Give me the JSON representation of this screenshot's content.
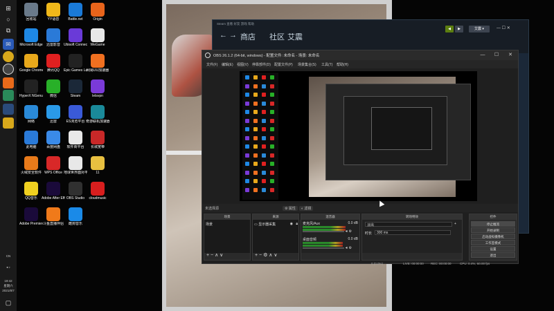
{
  "desktop": {
    "icons": [
      {
        "label": "回收站",
        "icon": "recycle-bin-icon",
        "color": "#6a7a8a"
      },
      {
        "label": "YY语音",
        "icon": "yy-voice-icon",
        "color": "#f0b81a"
      },
      {
        "label": "Battle.net",
        "icon": "battlenet-icon",
        "color": "#1a7ad8"
      },
      {
        "label": "Origin",
        "icon": "origin-icon",
        "color": "#e8641b"
      },
      {
        "label": "Microsoft Edge",
        "icon": "edge-icon",
        "color": "#1e88e5"
      },
      {
        "label": "迅雷影音",
        "icon": "xunlei-player-icon",
        "color": "#2a7ad8"
      },
      {
        "label": "Ubisoft Connect",
        "icon": "ubisoft-icon",
        "color": "#6a3ad8"
      },
      {
        "label": "WeGame",
        "icon": "wegame-icon",
        "color": "#e8e8e8"
      },
      {
        "label": "Google Chrome",
        "icon": "chrome-icon",
        "color": "#e8a81b"
      },
      {
        "label": "腾讯QQ",
        "icon": "qq-icon",
        "color": "#e02020"
      },
      {
        "label": "Epic Games Launcher",
        "icon": "epic-games-icon",
        "color": "#222222"
      },
      {
        "label": "网易UU加速器",
        "icon": "uu-accelerator-icon",
        "color": "#f07020"
      },
      {
        "label": "HyperX NGenuity",
        "icon": "hyperx-icon",
        "color": "#222222"
      },
      {
        "label": "微信",
        "icon": "wechat-icon",
        "color": "#28b028"
      },
      {
        "label": "Steam",
        "icon": "steam-icon",
        "color": "#1b2838"
      },
      {
        "label": "letsvpn",
        "icon": "letsvpn-icon",
        "color": "#7a3ad8"
      },
      {
        "label": "网络",
        "icon": "network-icon",
        "color": "#2a8ad8"
      },
      {
        "label": "迅雷",
        "icon": "xunlei-icon",
        "color": "#2a9ae8"
      },
      {
        "label": "ES浏览平台",
        "icon": "es-platform-icon",
        "color": "#3a5ad8"
      },
      {
        "label": "奇游联机加速器",
        "icon": "qiyou-icon",
        "color": "#1a8a9a"
      },
      {
        "label": "此电脑",
        "icon": "this-pc-icon",
        "color": "#2a7ad8"
      },
      {
        "label": "百度网盘",
        "icon": "baidu-netdisk-icon",
        "color": "#3a8ae8"
      },
      {
        "label": "软件商平台",
        "icon": "doc-file-icon",
        "color": "#e8e8e8"
      },
      {
        "label": "长城宽带",
        "icon": "greatwall-icon",
        "color": "#c82828"
      },
      {
        "label": "火绒安全软件",
        "icon": "huorong-icon",
        "color": "#e87a1a"
      },
      {
        "label": "WPS Office",
        "icon": "wps-icon",
        "color": "#d82828"
      },
      {
        "label": "地球世界面对平台",
        "icon": "doc-file-icon",
        "color": "#e8e8e8"
      },
      {
        "label": "11",
        "icon": "folder-icon",
        "color": "#e8c040"
      },
      {
        "label": "QQ音乐",
        "icon": "qq-music-icon",
        "color": "#f0d020"
      },
      {
        "label": "Adobe After Effects CC ...",
        "icon": "after-effects-icon",
        "color": "#1a0a3a"
      },
      {
        "label": "OBS Studio",
        "icon": "obs-icon",
        "color": "#303030"
      },
      {
        "label": "cloudmusic",
        "icon": "netease-music-icon",
        "color": "#d81e1e"
      },
      {
        "label": "Adobe Premiere ...",
        "icon": "premiere-icon",
        "color": "#1a0a3a"
      },
      {
        "label": "斗鱼直播伴侣",
        "icon": "douyu-icon",
        "color": "#f07a1a"
      },
      {
        "label": "酷狗音乐",
        "icon": "kugou-icon",
        "color": "#1a8ae8"
      }
    ]
  },
  "taskbar": {
    "lang": "CN",
    "time": "19:42",
    "weekday": "星期六",
    "date": "2021/8/7"
  },
  "steam": {
    "nav": [
      "商店",
      "社区",
      "艾震"
    ],
    "menu_hint": "Steam  查看  好友  游戏  帮助",
    "buttons": [
      "◀",
      "▶",
      "艾震 ▾"
    ]
  },
  "obs": {
    "title": "OBS 26.1.2 (64-bit, windows) - 配置文件: 未命名 - 场景: 未命名",
    "menu": [
      "文件(F)",
      "编辑(E)",
      "视图(V)",
      "停靠部件(D)",
      "配置文件(P)",
      "场景集合(S)",
      "工具(T)",
      "帮助(H)"
    ],
    "status_left": "未选择源",
    "status_btn1": "属性",
    "status_btn2": "滤镜",
    "docks": {
      "scenes": {
        "title": "场景",
        "items": [
          "场景"
        ]
      },
      "sources": {
        "title": "来源",
        "items": [
          "显示器采集"
        ]
      },
      "mixer": {
        "title": "混音器",
        "channels": [
          {
            "name": "麦克风/Aux",
            "db": "0.0 dB",
            "level": 0.78
          },
          {
            "name": "桌面音频",
            "db": "0.0 dB",
            "level": 0.72
          }
        ]
      },
      "transitions": {
        "title": "转场特效",
        "type": "淡出",
        "duration_label": "时长",
        "duration": "300 ms"
      },
      "controls": {
        "title": "控件",
        "buttons": [
          "停止推流",
          "开始录制",
          "启动虚拟摄像机",
          "工作室模式",
          "设置",
          "退出"
        ]
      }
    },
    "footer": {
      "live": "LIVE: 00:00:00",
      "rec": "REC: 00:00:00",
      "cpu": "CPU: 0.4%, 60.00 fps",
      "dropped": "0 (0.0%)"
    }
  }
}
